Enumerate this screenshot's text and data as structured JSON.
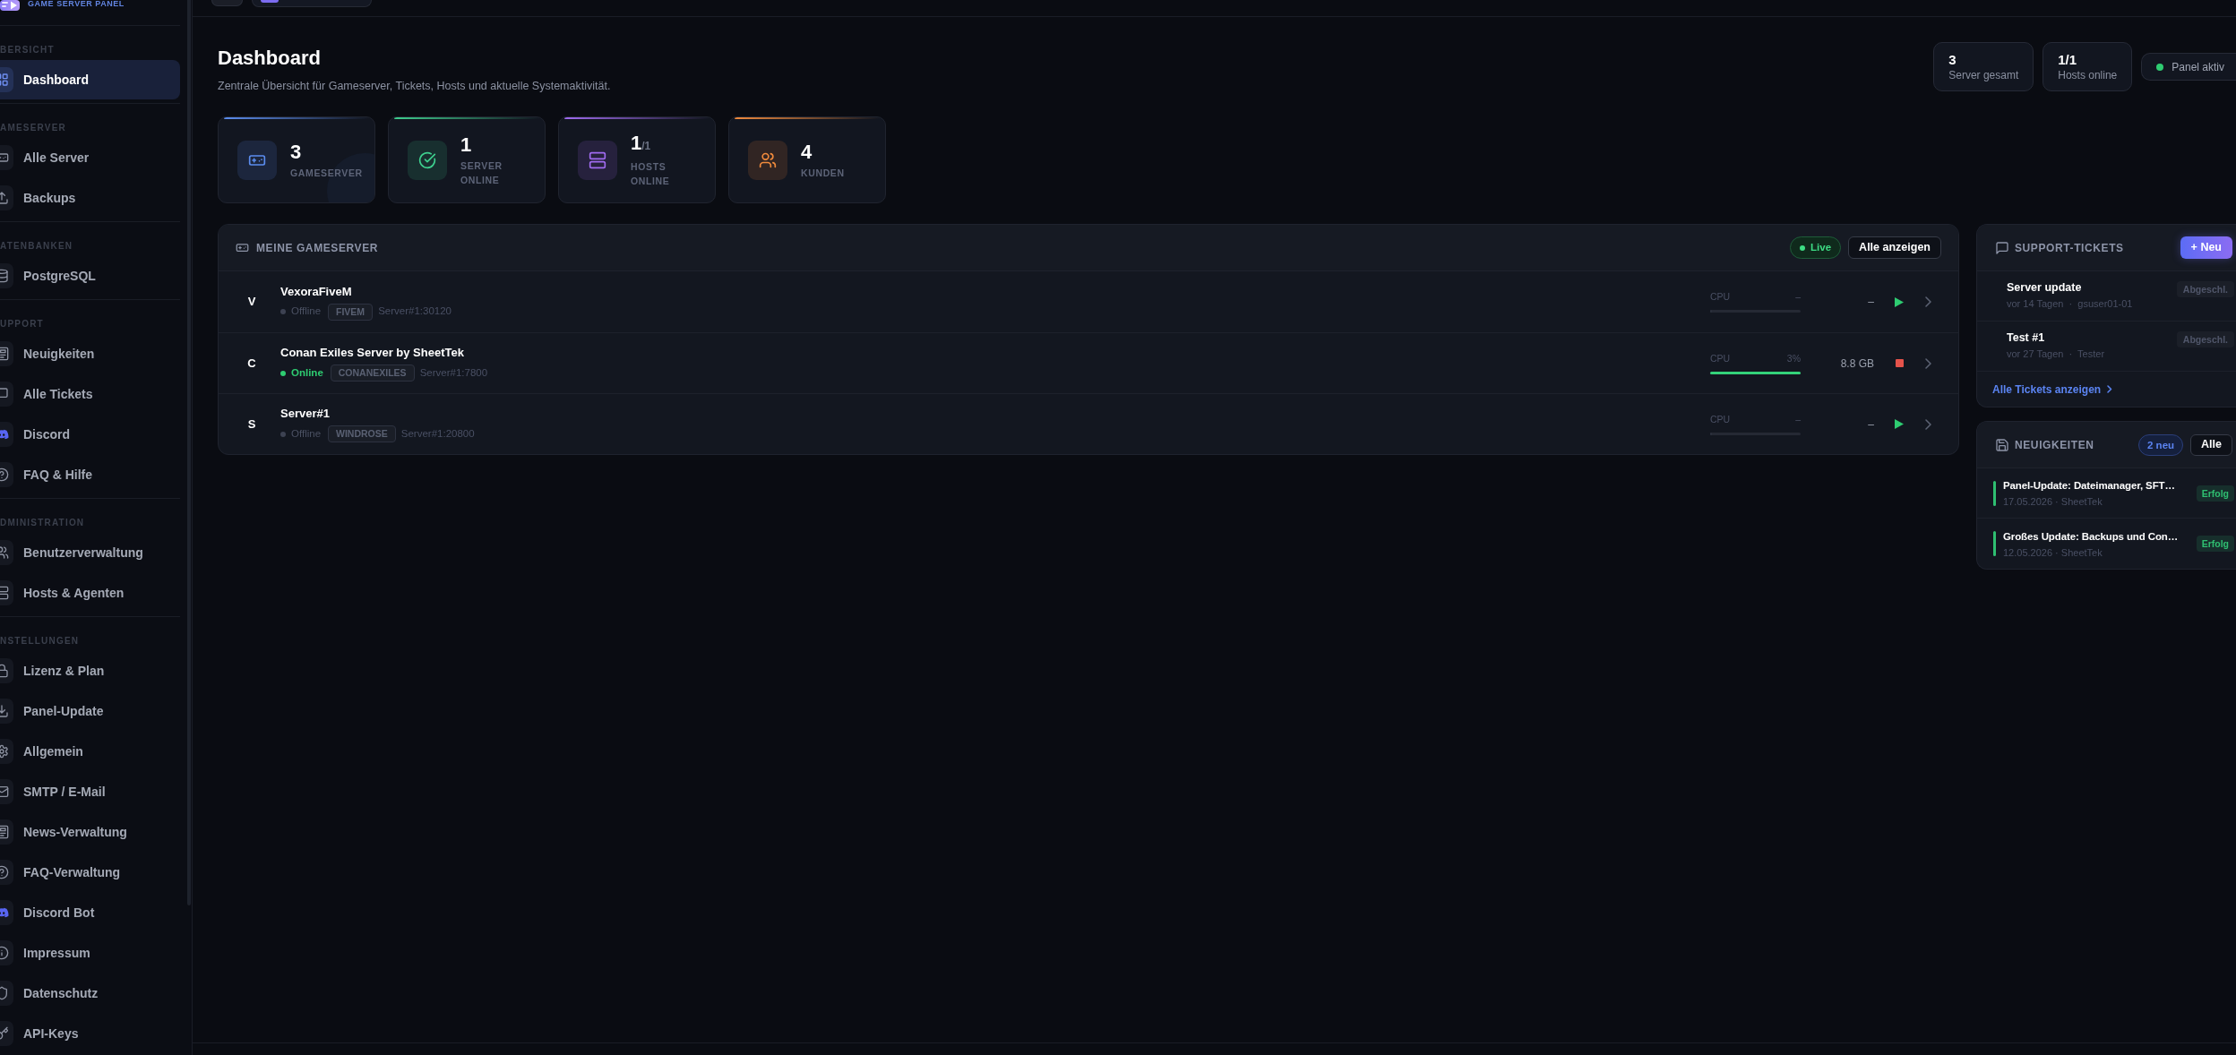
{
  "sidebar": {
    "logo": {
      "subtitle": "GAME SERVER PANEL"
    },
    "sections": [
      {
        "label": "BERSICHT",
        "items": [
          {
            "label": "Dashboard",
            "selected": true
          }
        ]
      },
      {
        "label": "AMESERVER",
        "items": [
          {
            "label": "Alle Server",
            "selected": false
          },
          {
            "label": "Backups",
            "selected": false
          }
        ]
      },
      {
        "label": "ATENBANKEN",
        "items": [
          {
            "label": "PostgreSQL",
            "selected": false
          }
        ]
      },
      {
        "label": "UPPORT",
        "items": [
          {
            "label": "Neuigkeiten",
            "selected": false
          },
          {
            "label": "Alle Tickets",
            "selected": false
          },
          {
            "label": "Discord",
            "selected": false
          },
          {
            "label": "FAQ & Hilfe",
            "selected": false
          }
        ]
      },
      {
        "label": "DMINISTRATION",
        "items": [
          {
            "label": "Benutzerverwaltung",
            "selected": false
          },
          {
            "label": "Hosts & Agenten",
            "selected": false
          }
        ]
      },
      {
        "label": "NSTELLUNGEN",
        "items": [
          {
            "label": "Lizenz & Plan",
            "selected": false
          },
          {
            "label": "Panel-Update",
            "selected": false
          },
          {
            "label": "Allgemein",
            "selected": false
          },
          {
            "label": "SMTP / E-Mail",
            "selected": false
          },
          {
            "label": "News-Verwaltung",
            "selected": false
          },
          {
            "label": "FAQ-Verwaltung",
            "selected": false
          },
          {
            "label": "Discord Bot",
            "selected": false
          },
          {
            "label": "Impressum",
            "selected": false
          },
          {
            "label": "Datenschutz",
            "selected": false
          },
          {
            "label": "API-Keys",
            "selected": false
          }
        ]
      }
    ]
  },
  "page_header": {
    "title": "Dashboard",
    "subtitle": "Zentrale Übersicht für Gameserver, Tickets, Hosts und aktuelle Systemaktivität."
  },
  "summary": [
    {
      "value": "3",
      "label": "Server gesamt"
    },
    {
      "value": "1/1",
      "label": "Hosts online"
    }
  ],
  "panel_status": {
    "label": "Panel aktiv",
    "active": true
  },
  "stat_cards": [
    {
      "value": "3",
      "label": "GAMESERVER",
      "color": "#5b8def",
      "hovered": true
    },
    {
      "value": "1",
      "label": "SERVER ONLINE",
      "color": "#3ecf8e",
      "hovered": false
    },
    {
      "value": "1",
      "total": "/1",
      "label": "HOSTS ONLINE",
      "color": "#a06bf0",
      "hovered": false
    },
    {
      "value": "4",
      "label": "KUNDEN",
      "color": "#f08a3c",
      "hovered": false
    }
  ],
  "gameservers": {
    "title": "MEINE GAMESERVER",
    "live_badge": "Live",
    "view_all": "Alle anzeigen",
    "rows": [
      {
        "initial": "V",
        "name": "VexoraFiveM",
        "online": false,
        "status": "Offline",
        "game": "FIVEM",
        "address": "Server#1:30120",
        "cpu_label": "CPU",
        "cpu": "–",
        "level": 0,
        "memory": "–"
      },
      {
        "initial": "C",
        "name": "Conan Exiles Server by SheetTek",
        "online": true,
        "status": "Online",
        "game": "CONANEXILES",
        "address": "Server#1:7800",
        "cpu_label": "CPU",
        "cpu": "3%",
        "level": 1,
        "memory": "8.8 GB"
      },
      {
        "initial": "S",
        "name": "Server#1",
        "online": false,
        "status": "Offline",
        "game": "WINDROSE",
        "address": "Server#1:20800",
        "cpu_label": "CPU",
        "cpu": "–",
        "level": 0,
        "memory": "–"
      }
    ]
  },
  "support_tickets": {
    "title": "SUPPORT-TICKETS",
    "new_button": "+ Neu",
    "tickets": [
      {
        "title": "Server update",
        "meta": "vor 14 Tagen  ·  gsuser01-01",
        "status": "Abgeschl."
      },
      {
        "title": "Test #1",
        "meta": "vor 27 Tagen  ·  Tester",
        "status": "Abgeschl."
      }
    ],
    "footer_link": "Alle Tickets anzeigen"
  },
  "news": {
    "title": "NEUIGKEITEN",
    "new_count": "2 neu",
    "all_button": "Alle",
    "items": [
      {
        "title": "Panel-Update: Dateimanager, SFT…",
        "meta": "17.05.2026 · SheetTek",
        "badge": "Erfolg",
        "color": "#2fbf71"
      },
      {
        "title": "Großes Update: Backups und Con…",
        "meta": "12.05.2026 · SheetTek",
        "badge": "Erfolg",
        "color": "#2fbf71"
      }
    ]
  }
}
